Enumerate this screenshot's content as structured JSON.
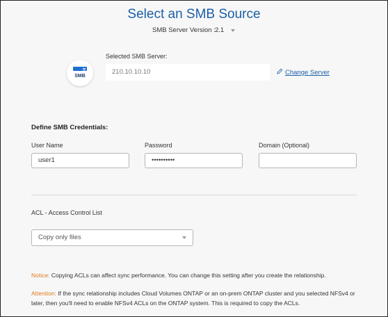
{
  "header": {
    "title": "Select an SMB Source",
    "version_label": "SMB Server Version :",
    "version_value": "2.1"
  },
  "server": {
    "icon_label": "SMB",
    "selected_label": "Selected SMB Server:",
    "value": "210.10.10.10",
    "change_link": "Change Server"
  },
  "credentials": {
    "heading": "Define SMB Credentials:",
    "username_label": "User Name",
    "username_value": "user1",
    "password_label": "Password",
    "password_value": "••••••••••",
    "domain_label": "Domain (Optional)",
    "domain_value": ""
  },
  "acl": {
    "label": "ACL - Access Control List",
    "selected": "Copy only files"
  },
  "messages": {
    "notice_prefix": "Notice:",
    "notice_text": "Copying ACLs can affect sync performance. You can change this setting after you create the relationship.",
    "attention_prefix": "Attention:",
    "attention_text": "If the sync relationship includes Cloud Volumes ONTAP or an on-prem ONTAP cluster and you selected NFSv4 or later, then you'll need to enable NFSv4 ACLs on the ONTAP system. This is required to copy the ACLs."
  },
  "colors": {
    "accent": "#1b5fa8",
    "warning": "#e07a1f",
    "smb_icon": "#1e6fd0"
  }
}
